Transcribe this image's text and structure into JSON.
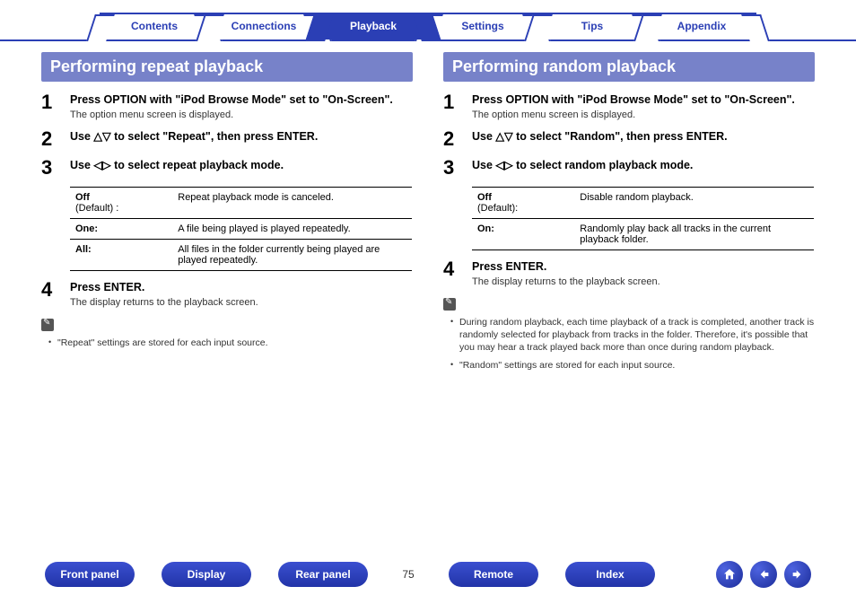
{
  "topnav": {
    "tabs": [
      {
        "label": "Contents",
        "active": false
      },
      {
        "label": "Connections",
        "active": false
      },
      {
        "label": "Playback",
        "active": true
      },
      {
        "label": "Settings",
        "active": false
      },
      {
        "label": "Tips",
        "active": false
      },
      {
        "label": "Appendix",
        "active": false
      }
    ]
  },
  "left": {
    "title": "Performing repeat playback",
    "step1_title": "Press OPTION with \"iPod Browse Mode\" set to \"On-Screen\".",
    "step1_sub": "The option menu screen is displayed.",
    "step2_title": "Use △▽ to select \"Repeat\", then press ENTER.",
    "step3_title": "Use ◁▷ to select repeat playback mode.",
    "opts": [
      {
        "k_main": "Off",
        "k_sub": "(Default) :",
        "v": "Repeat playback mode is canceled."
      },
      {
        "k_main": "One:",
        "k_sub": "",
        "v": "A file being played is played repeatedly."
      },
      {
        "k_main": "All:",
        "k_sub": "",
        "v": "All files in the folder currently being played are played repeatedly."
      }
    ],
    "step4_title": "Press ENTER.",
    "step4_sub": "The display returns to the playback screen.",
    "notes": [
      "\"Repeat\" settings are stored for each input source."
    ]
  },
  "right": {
    "title": "Performing random playback",
    "step1_title": "Press OPTION with \"iPod Browse Mode\" set to \"On-Screen\".",
    "step1_sub": "The option menu screen is displayed.",
    "step2_title": "Use △▽ to select \"Random\", then press ENTER.",
    "step3_title": "Use ◁▷ to select random playback mode.",
    "opts": [
      {
        "k_main": "Off",
        "k_sub": "(Default):",
        "v": "Disable random playback."
      },
      {
        "k_main": "On:",
        "k_sub": "",
        "v": "Randomly play back all tracks in the current playback folder."
      }
    ],
    "step4_title": "Press ENTER.",
    "step4_sub": "The display returns to the playback screen.",
    "notes": [
      "During random playback, each time playback of a track is completed, another track is randomly selected for playback from tracks in the folder. Therefore, it's possible that you may hear a track played back more than once during random playback.",
      "\"Random\" settings are stored for each input source."
    ]
  },
  "footer": {
    "buttons": [
      "Front panel",
      "Display",
      "Rear panel"
    ],
    "page": "75",
    "buttons2": [
      "Remote",
      "Index"
    ]
  }
}
